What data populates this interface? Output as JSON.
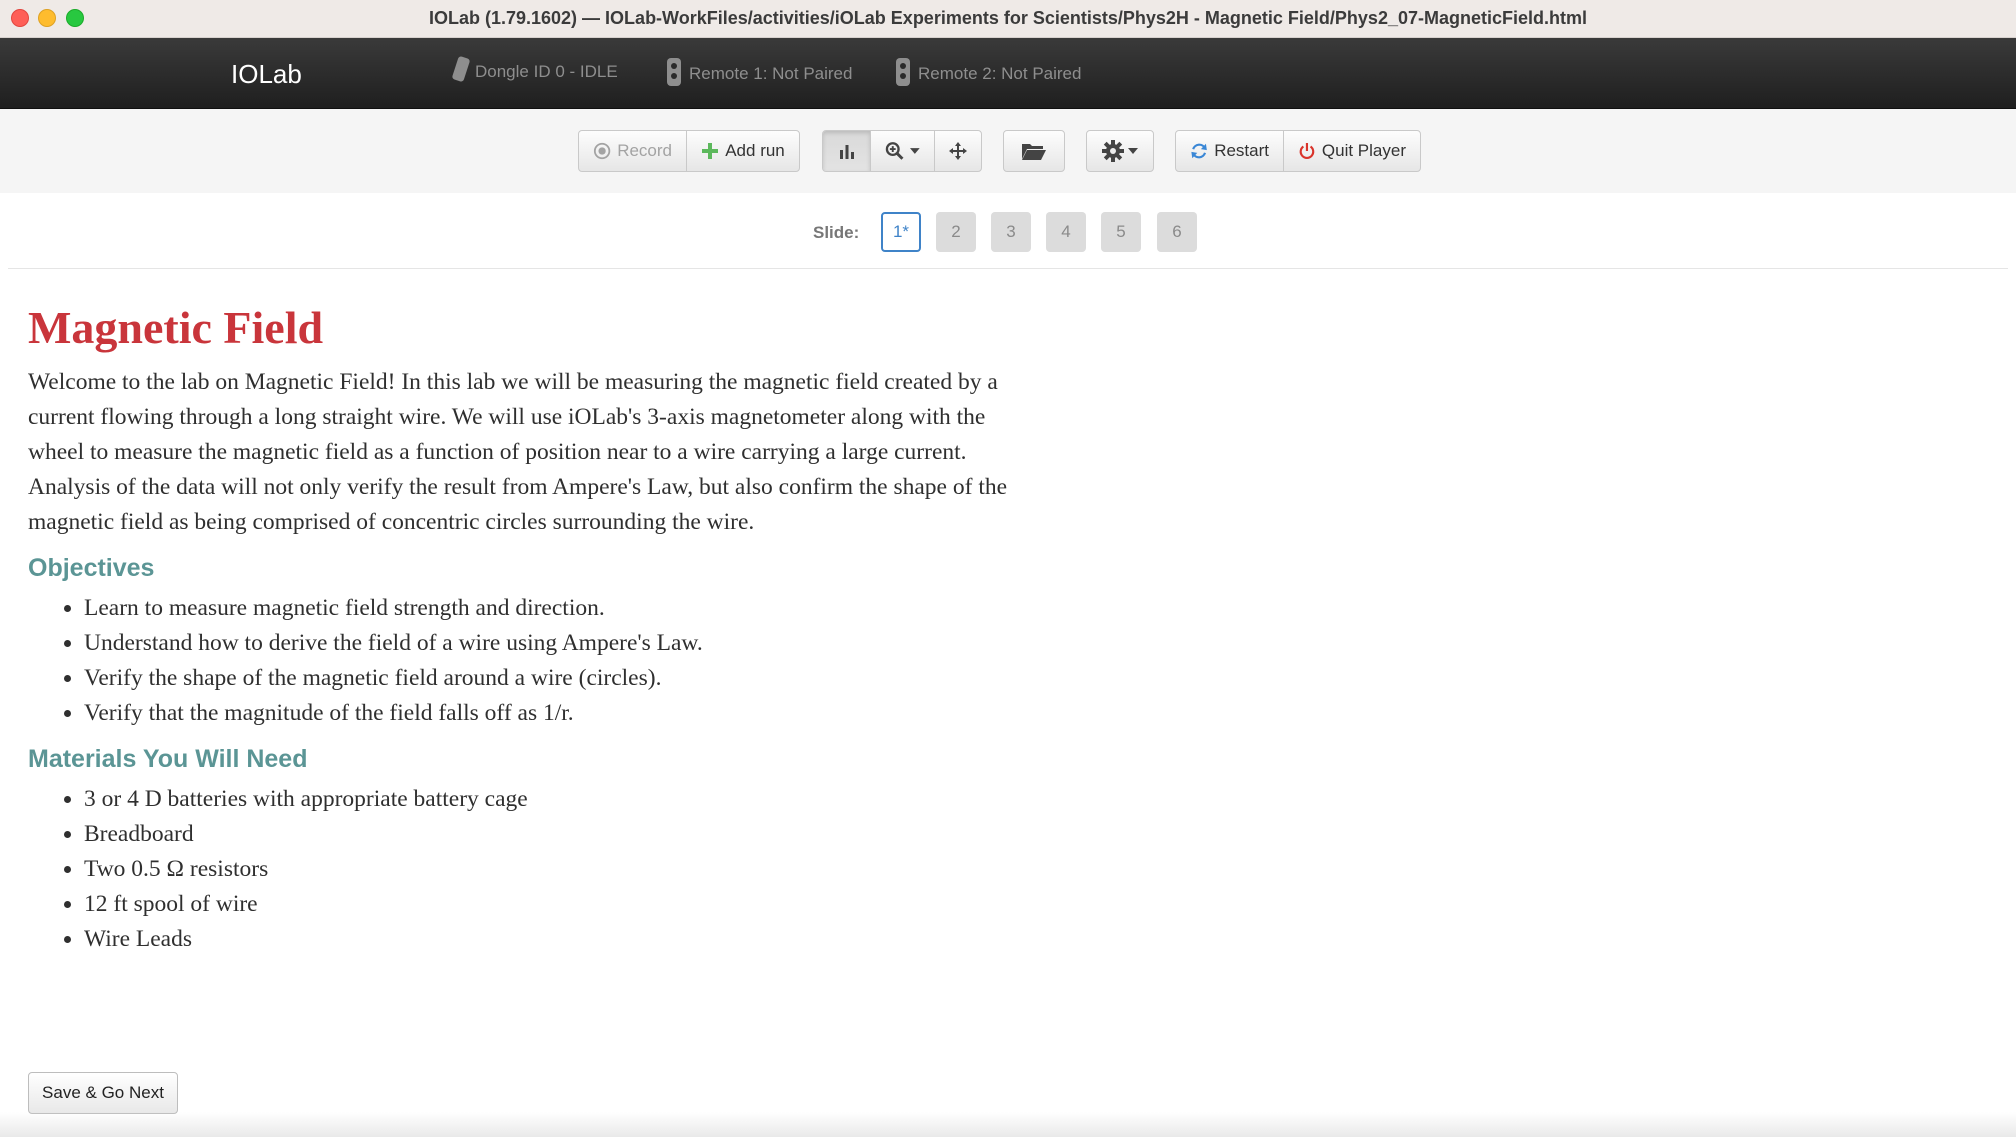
{
  "window": {
    "title": "IOLab (1.79.1602) — IOLab-WorkFiles/activities/iOLab Experiments for Scientists/Phys2H - Magnetic Field/Phys2_07-MagneticField.html"
  },
  "navbar": {
    "brand": "IOLab",
    "dongle": "Dongle ID 0 - IDLE",
    "remote1": "Remote 1: Not Paired",
    "remote2": "Remote 2: Not Paired"
  },
  "toolbar": {
    "record_label": "Record",
    "add_run_label": "Add run",
    "restart_label": "Restart",
    "quit_label": "Quit Player"
  },
  "slides": {
    "label": "Slide:",
    "items": [
      "1*",
      "2",
      "3",
      "4",
      "5",
      "6"
    ],
    "current": 0
  },
  "content": {
    "title": "Magnetic Field",
    "intro": "Welcome to the lab on Magnetic Field! In this lab we will be measuring the magnetic field created by a current flowing through a long straight wire. We will use iOLab's 3-axis magnetometer along with the wheel to measure the magnetic field as a function of position near to a wire carrying a large current. Analysis of the data will not only verify the result from Ampere's Law, but also confirm the shape of the magnetic field as being comprised of concentric circles surrounding the wire.",
    "objectives_heading": "Objectives",
    "objectives": [
      "Learn to measure magnetic field strength and direction.",
      "Understand how to derive the field of a wire using Ampere's Law.",
      "Verify the shape of the magnetic field around a wire (circles).",
      "Verify that the magnitude of the field falls off as 1/r."
    ],
    "materials_heading": "Materials You Will Need",
    "materials": [
      "3 or 4 D batteries with appropriate battery cage",
      "Breadboard",
      "Two 0.5 Ω resistors",
      "12 ft spool of wire",
      "Wire Leads"
    ],
    "save_button": "Save & Go Next"
  },
  "colors": {
    "title_red": "#c9353b",
    "heading_teal": "#5b9595",
    "slide_accent": "#3f83c8",
    "restart_icon": "#3a87d6",
    "quit_icon": "#d9342b",
    "add_icon": "#5cb85c"
  },
  "icons": {
    "record": "record-circle-icon",
    "add_run": "plus-icon",
    "chart": "bar-chart-icon",
    "zoom": "zoom-in-icon",
    "move": "move-arrows-icon",
    "folder": "folder-open-icon",
    "settings": "gear-icon",
    "restart": "refresh-icon",
    "quit": "power-icon"
  }
}
